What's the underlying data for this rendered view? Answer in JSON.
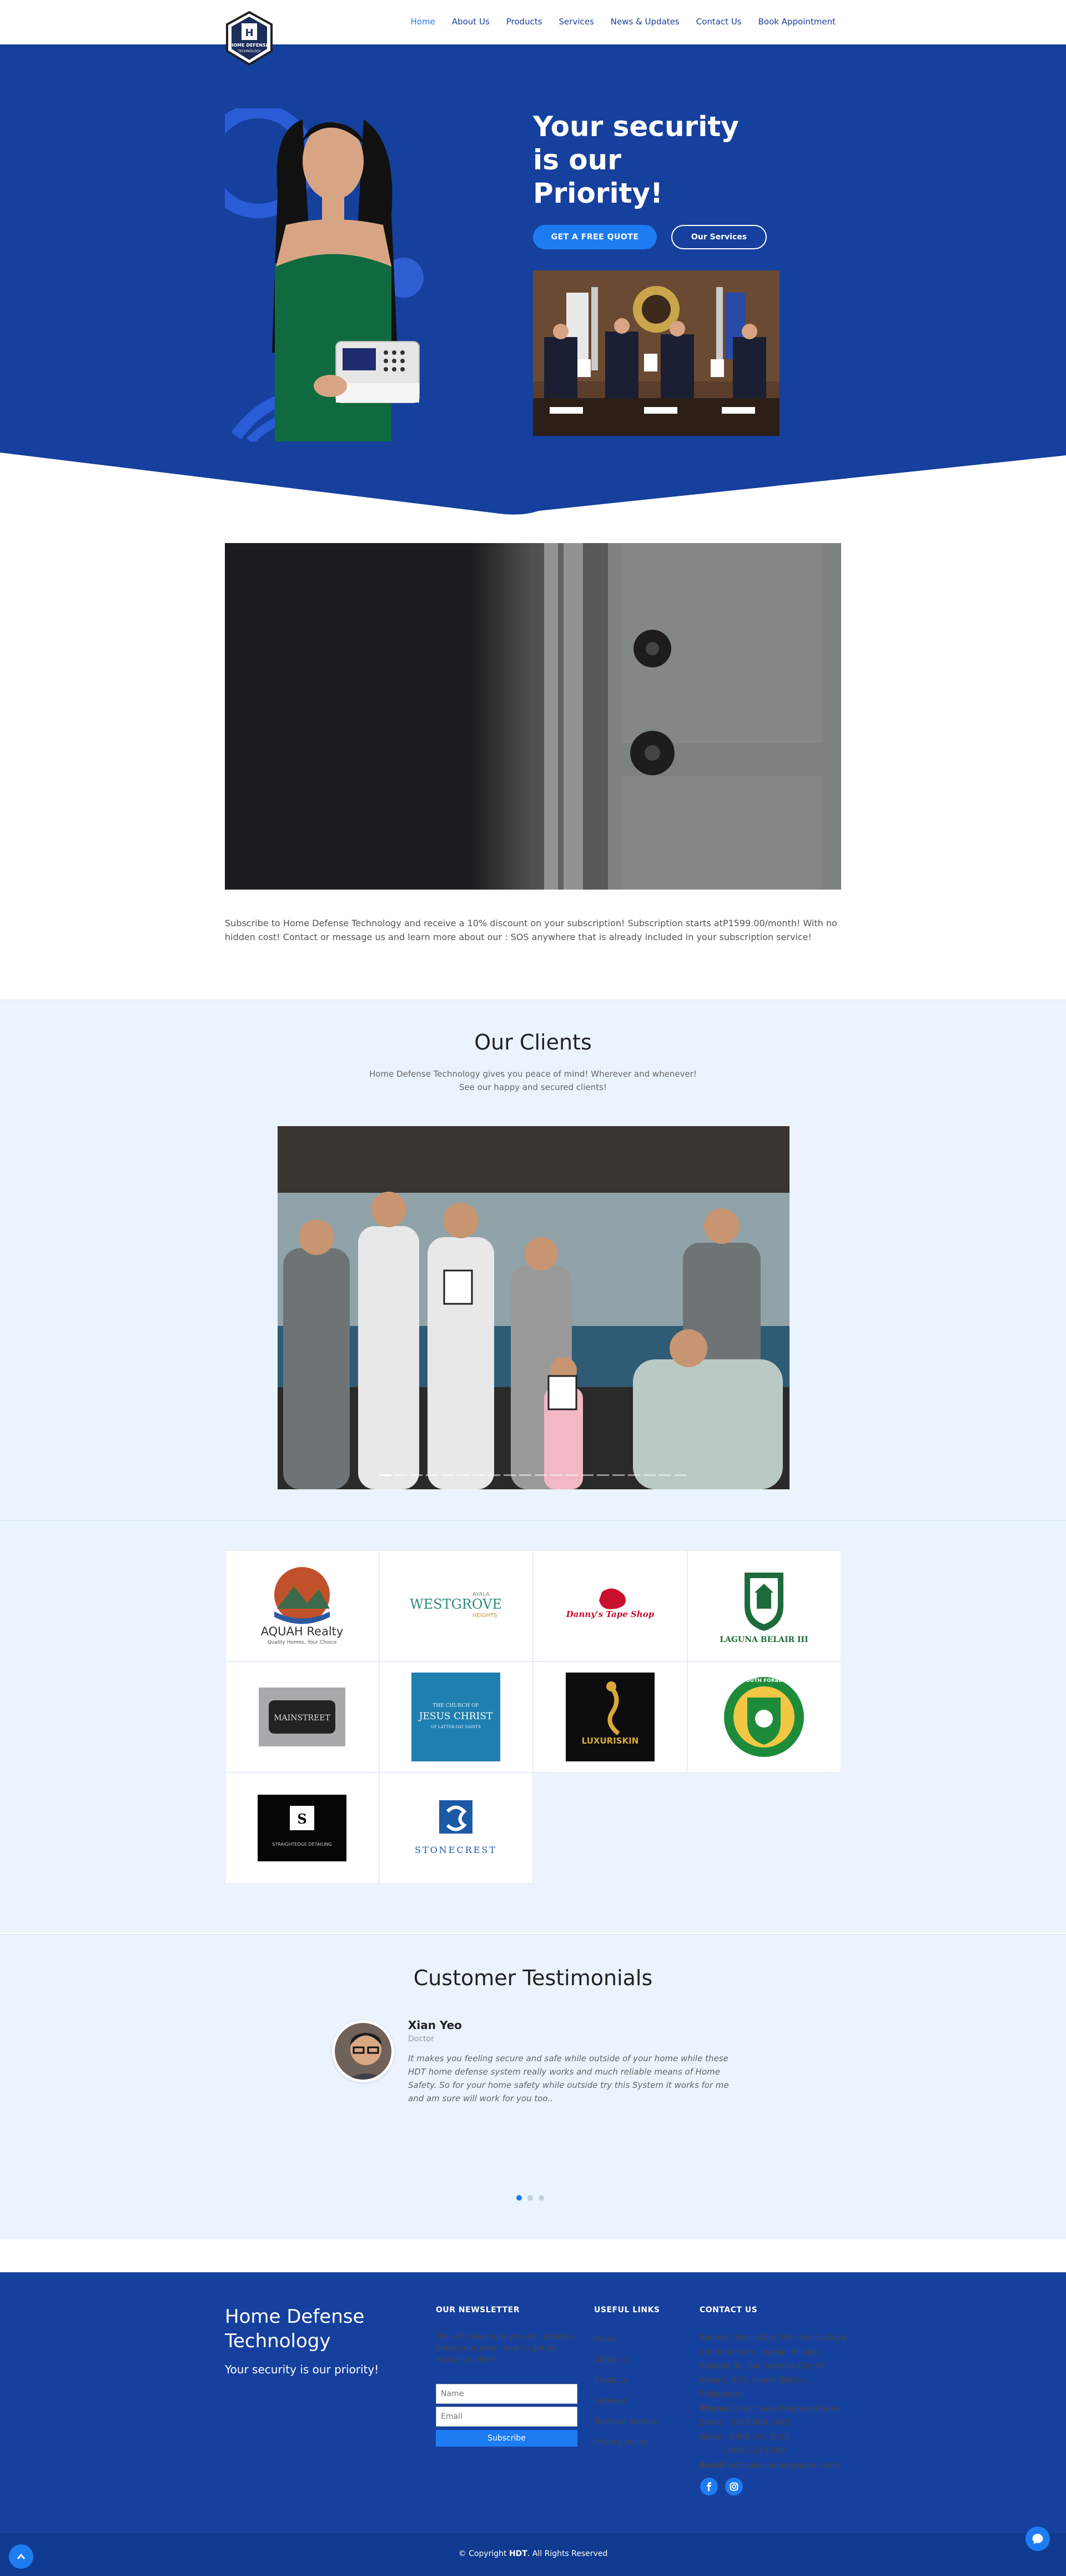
{
  "brand": {
    "logo_text": "HOME DEFENSE TECHNOLOGY"
  },
  "nav": {
    "items": [
      "Home",
      "About Us",
      "Products",
      "Services",
      "News & Updates",
      "Contact Us",
      "Book Appointment"
    ],
    "active": "Home"
  },
  "hero": {
    "title_lines": [
      "Your security",
      "is our",
      "Priority!"
    ],
    "quote_button": "GET A FREE QUOTE",
    "services_button": "Our Services"
  },
  "promo": {
    "text": "Subscribe to Home Defense Technology and receive a 10% discount on your subscription! Subscription starts atP1599.00/month! With no hidden cost! Contact or message us and learn more about our : SOS anywhere that is already included in your subscription service!"
  },
  "clients": {
    "title": "Our Clients",
    "subtitle_lines": [
      "Home Defense Technology gives you peace of mind! Wherever and whenever!",
      "See our happy and secured clients!"
    ],
    "slide_count": 20,
    "active_slide": 1,
    "logos": [
      {
        "name": "aquah-realty-logo",
        "text": "AQUAH Realty",
        "tag": "Quality Homes, Your Choice"
      },
      {
        "name": "westgrove-logo",
        "text": "WESTGROVE",
        "top": "AYALA",
        "bottom": "HEIGHTS"
      },
      {
        "name": "dannys-tape-shop-logo",
        "text": "Danny's Tape Shop"
      },
      {
        "name": "laguna-belair-logo",
        "text": "LAGUNA BELAIR III"
      },
      {
        "name": "mainstreet-logo",
        "text": "MAINSTREET"
      },
      {
        "name": "church-logo",
        "text": "JESUS CHRIST",
        "top": "THE CHURCH OF",
        "bottom": "OF LATTER-DAY SAINTS"
      },
      {
        "name": "luxuriskin-logo",
        "text": "LUXURISKIN"
      },
      {
        "name": "south-forbes-logo",
        "text": "SOUTH FORBES"
      },
      {
        "name": "detailing-logo",
        "text": "STRAIGHTEDGE DETAILING"
      },
      {
        "name": "stonecrest-logo",
        "text": "STONECREST"
      }
    ]
  },
  "testimonials": {
    "title": "Customer Testimonials",
    "name": "Xian Yeo",
    "role": "Doctor",
    "quote": "It makes you feeling secure and safe while outside of your home while these HDT home defense system really works and much reliable means of Home Safety. So for your home safety while outside try this System it works for me and am sure will work for you too..",
    "dots": 3,
    "active": 1
  },
  "footer": {
    "brand_lines": [
      "Home Defense",
      "Technology"
    ],
    "slogan": "Your security is our priority!",
    "newsletter_heading": "OUR NEWSLETTER",
    "newsletter_text": "We will make sure you are updated, enter your email now to get an exclusive offer!",
    "name_placeholder": "Name",
    "email_placeholder": "Email",
    "subscribe_label": "Subscribe",
    "links_heading": "USEFUL LINKS",
    "links": [
      "Home",
      "About us",
      "Products",
      "Services",
      "Terms of service",
      "Privacy policy"
    ],
    "contact_heading": "CONTACT US",
    "address_label": "Address:",
    "address": "Unit 502-b 5th Floor Catleya Condominium, Legaspi Village, Salcedo St., San Lorenzo City Of Makati, NCR, Fourth District, Philippines",
    "phone_label": "Phone:",
    "phone_title": "Direct Sales Representative",
    "smart": "Smart - 0919 888 5475",
    "globe1": "Globe - 0906 095 3635",
    "globe2": "- 0995 621 6388",
    "email_label": "Email:",
    "email": "hdt.salesinquiry@gmail.com",
    "copyright_pre": "© Copyright ",
    "copyright_brand": "HDT",
    "copyright_post": ". All Rights Reserved"
  },
  "colors": {
    "primary": "#16409e",
    "accent": "#1e7cf2",
    "section_bg": "#eaf3fe"
  }
}
